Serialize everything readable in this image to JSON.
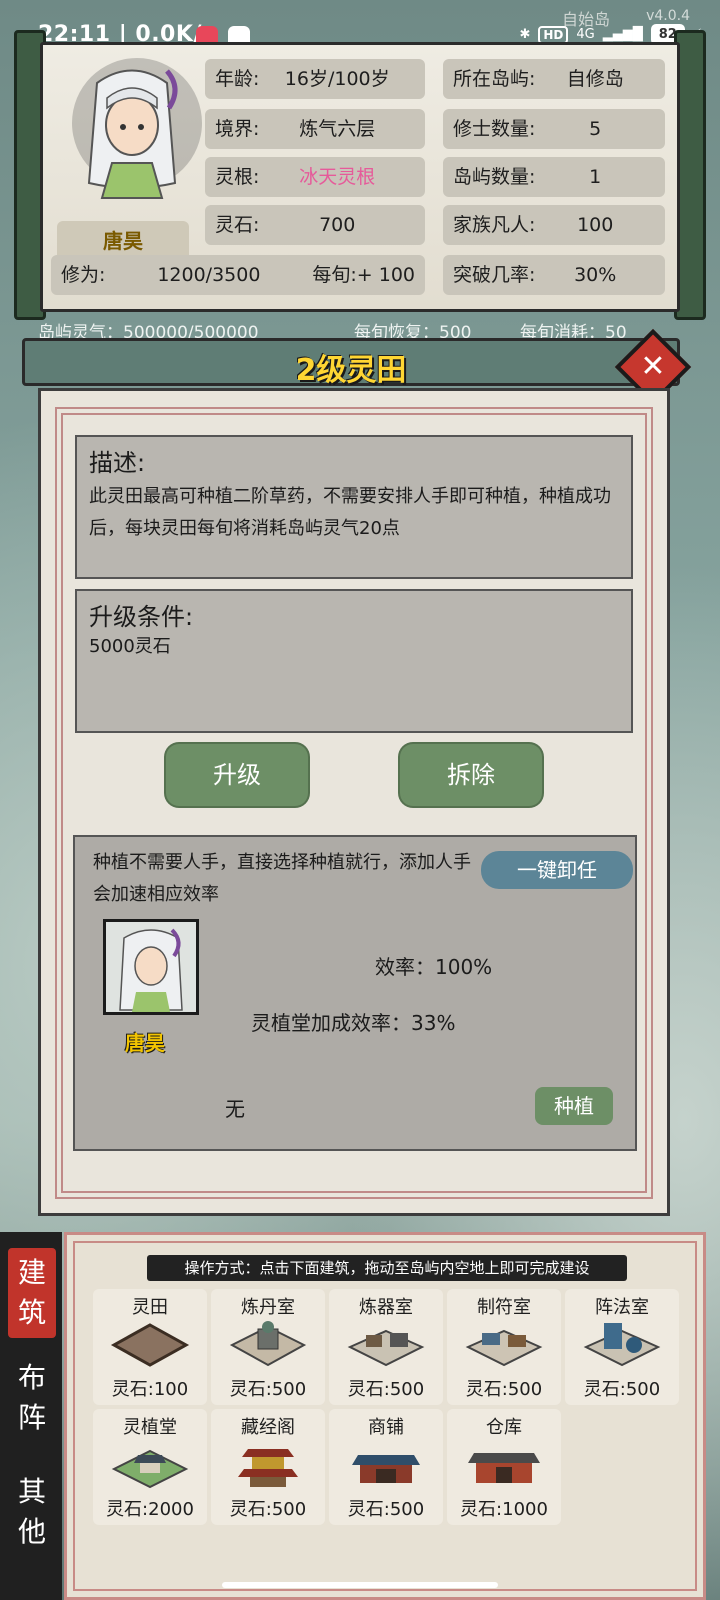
{
  "status": {
    "time": "22:11",
    "net_speed": "0.0K/s",
    "network": "4G",
    "hd": "HD",
    "battery": "82"
  },
  "game": {
    "island_name": "自始岛",
    "version": "v4.0.4"
  },
  "profile": {
    "name": "唐昊",
    "age_label": "年龄:",
    "age_value": "16岁/100岁",
    "island_label": "所在岛屿:",
    "island_value": "自修岛",
    "realm_label": "境界:",
    "realm_value": "炼气六层",
    "cultivators_label": "修士数量:",
    "cultivators_value": "5",
    "root_label": "灵根:",
    "root_value": "冰天灵根",
    "islands_label": "岛屿数量:",
    "islands_value": "1",
    "stones_label": "灵石:",
    "stones_value": "700",
    "mortals_label": "家族凡人:",
    "mortals_value": "100",
    "cultivation_label": "修为:",
    "cultivation_value": "1200/3500",
    "per_turn_label": "每旬:",
    "per_turn_value": "+ 100",
    "breakthrough_label": "突破几率:",
    "breakthrough_value": "30%"
  },
  "island_bar": {
    "qi": "岛屿灵气：500000/500000",
    "recover": "每旬恢复：500",
    "consume": "每旬消耗：50"
  },
  "modal": {
    "title": "2级灵田",
    "desc_head": "描述:",
    "desc_body": "此灵田最高可种植二阶草药，不需要安排人手即可种植，种植成功后，每块灵田每旬将消耗岛屿灵气20点",
    "upgrade_head": "升级条件:",
    "upgrade_body": "5000灵石",
    "upgrade_button": "升级",
    "demolish_button": "拆除",
    "worker_note": "种植不需要人手，直接选择种植就行，添加人手会加速相应效率",
    "unassign_button": "一键卸任",
    "worker_name": "唐昊",
    "efficiency": "效率：100%",
    "bonus": "灵植堂加成效率：33%",
    "planted": "无",
    "plant_button": "种植"
  },
  "tabs": [
    "建筑",
    "布阵",
    "其他"
  ],
  "build_hint": "操作方式：点击下面建筑，拖动至岛屿内空地上即可完成建设",
  "buildings": [
    {
      "name": "灵田",
      "cost": "灵石:100"
    },
    {
      "name": "炼丹室",
      "cost": "灵石:500"
    },
    {
      "name": "炼器室",
      "cost": "灵石:500"
    },
    {
      "name": "制符室",
      "cost": "灵石:500"
    },
    {
      "name": "阵法室",
      "cost": "灵石:500"
    },
    {
      "name": "灵植堂",
      "cost": "灵石:2000"
    },
    {
      "name": "藏经阁",
      "cost": "灵石:500"
    },
    {
      "name": "商铺",
      "cost": "灵石:500"
    },
    {
      "name": "仓库",
      "cost": "灵石:1000"
    }
  ],
  "colors": {
    "accent_yellow": "#ffd633",
    "root_pink": "#e65a9a",
    "button_green": "#6d8f66",
    "close_red": "#c6372e"
  }
}
